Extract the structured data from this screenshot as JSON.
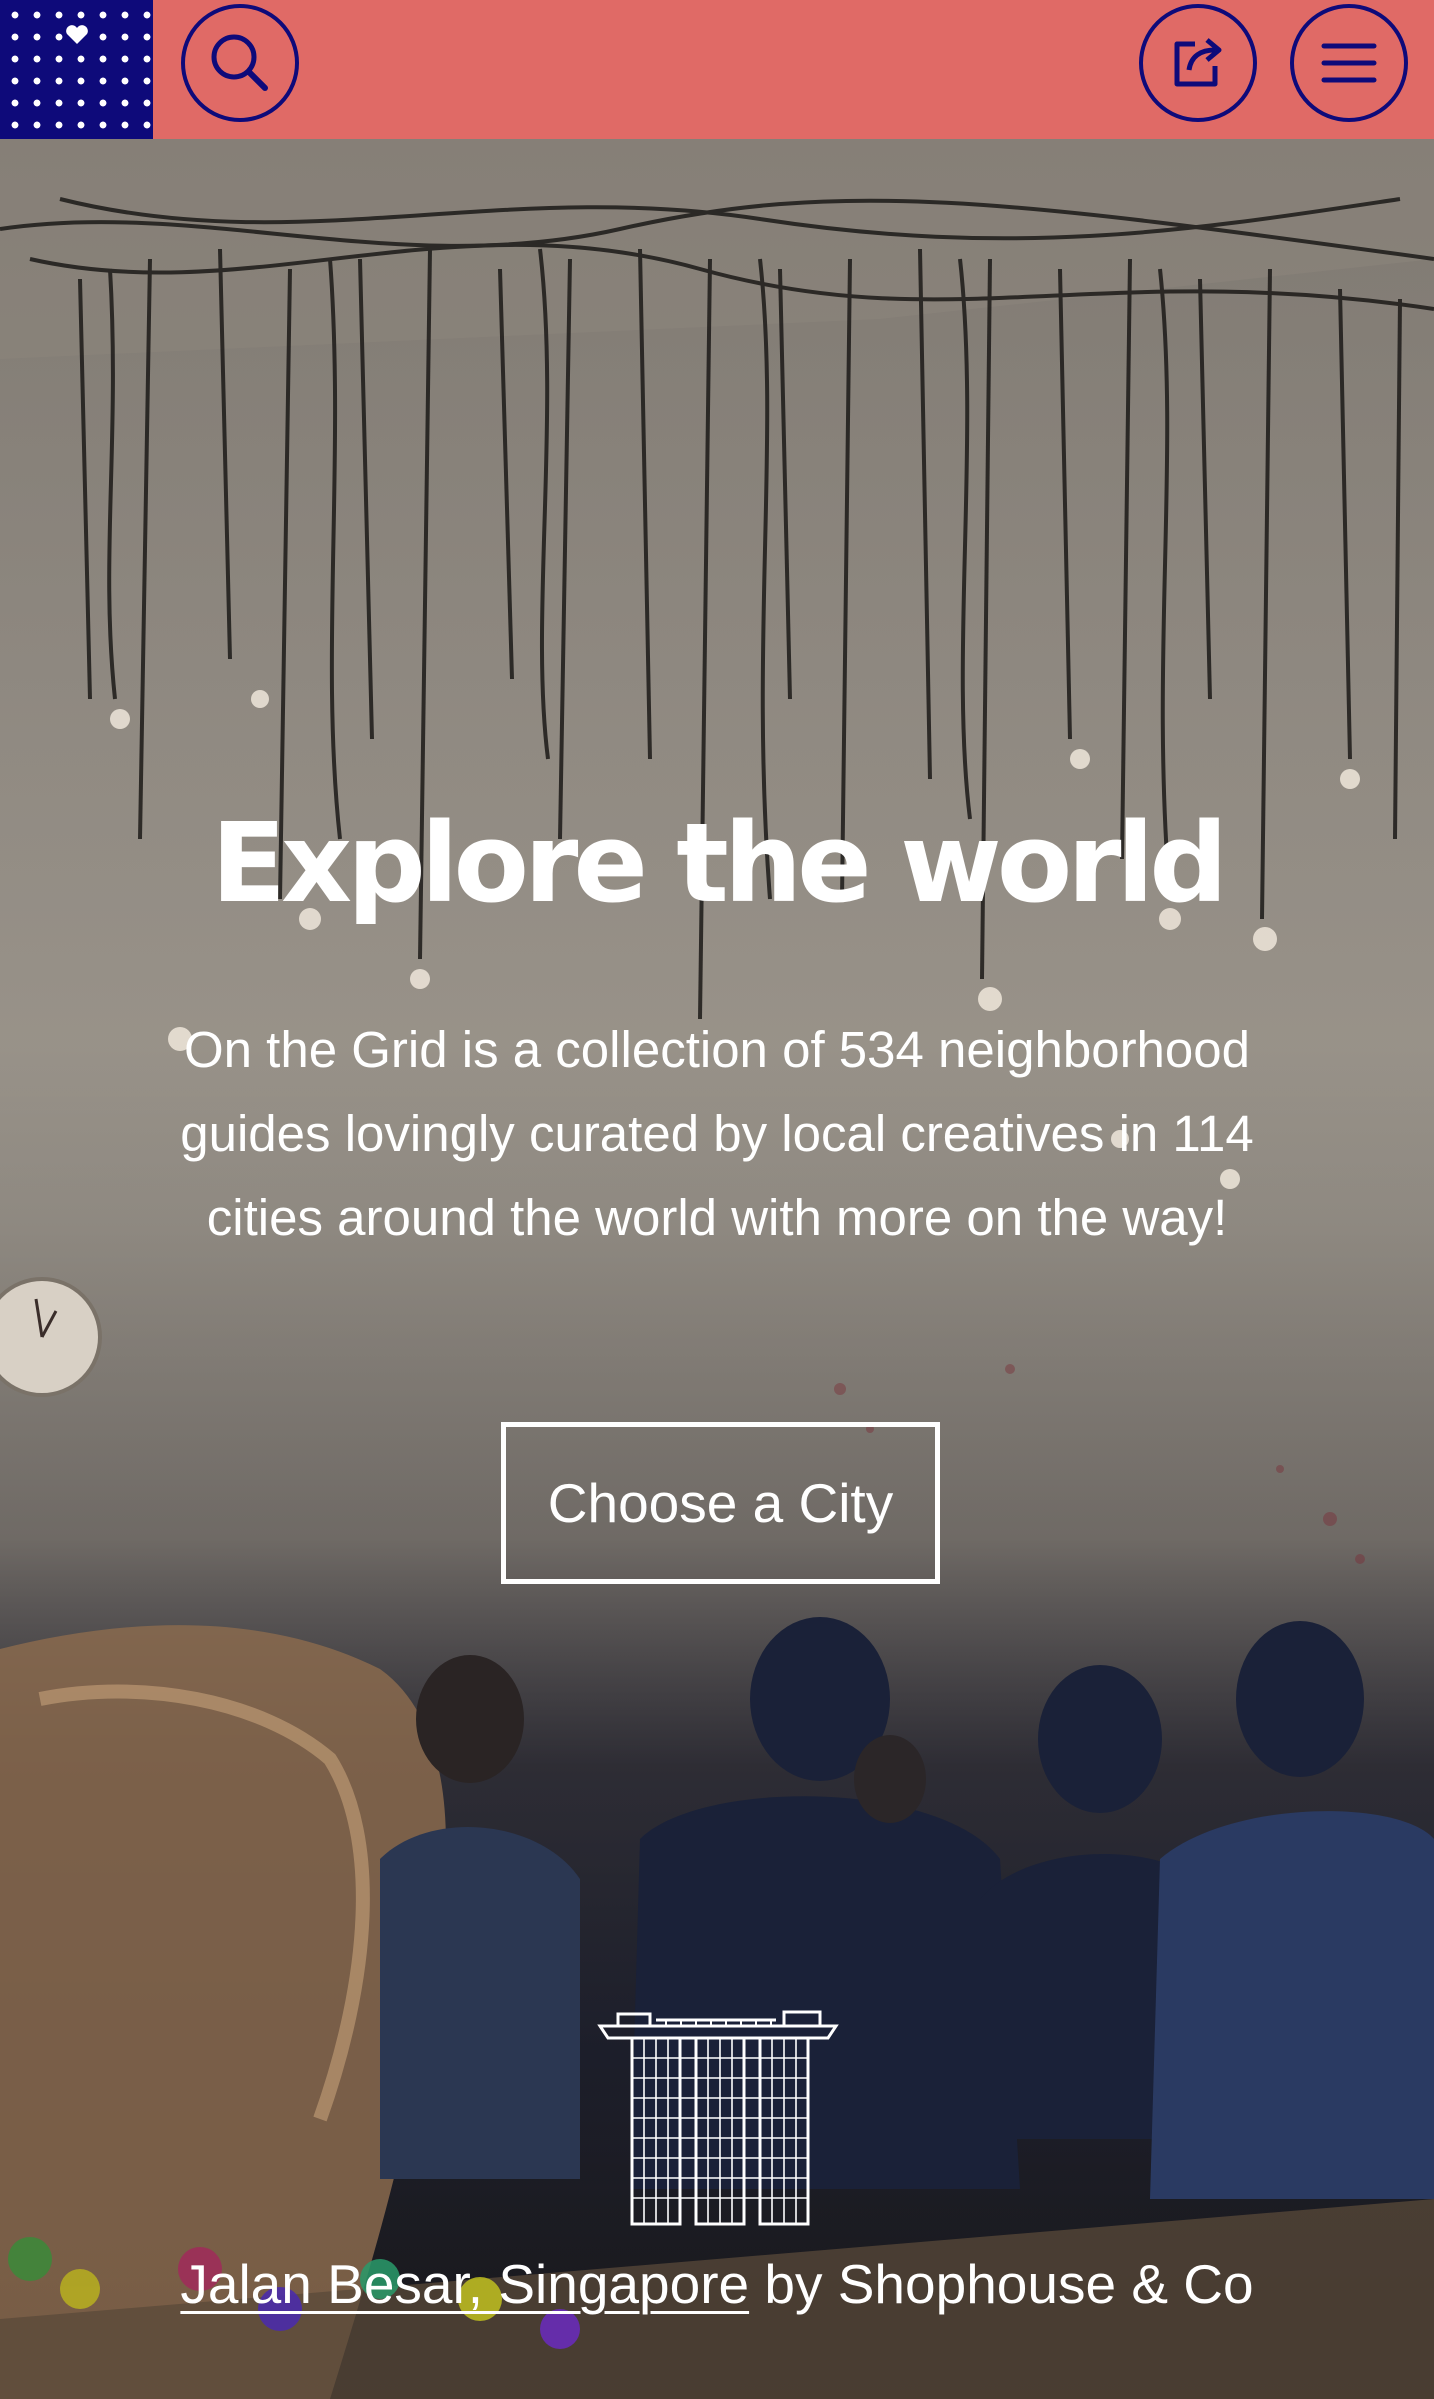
{
  "header": {
    "logo_icon": "heart-dots-logo",
    "search_icon": "search-icon",
    "share_icon": "share-icon",
    "menu_icon": "hamburger-menu-icon",
    "background_color": "#e06a66",
    "accent_color": "#0e0a7a"
  },
  "hero": {
    "title": "Explore the world",
    "intro": "On the Grid is a collection of 534 neighborhood guides lovingly curated by local creatives in 114 cities around the world with more on the way!",
    "cta_label": "Choose a City",
    "landmark_icon": "marina-bay-sands-icon",
    "credit": {
      "location_link": "Jalan Besar, Singapore",
      "by_text": " by Shophouse & Co"
    }
  }
}
